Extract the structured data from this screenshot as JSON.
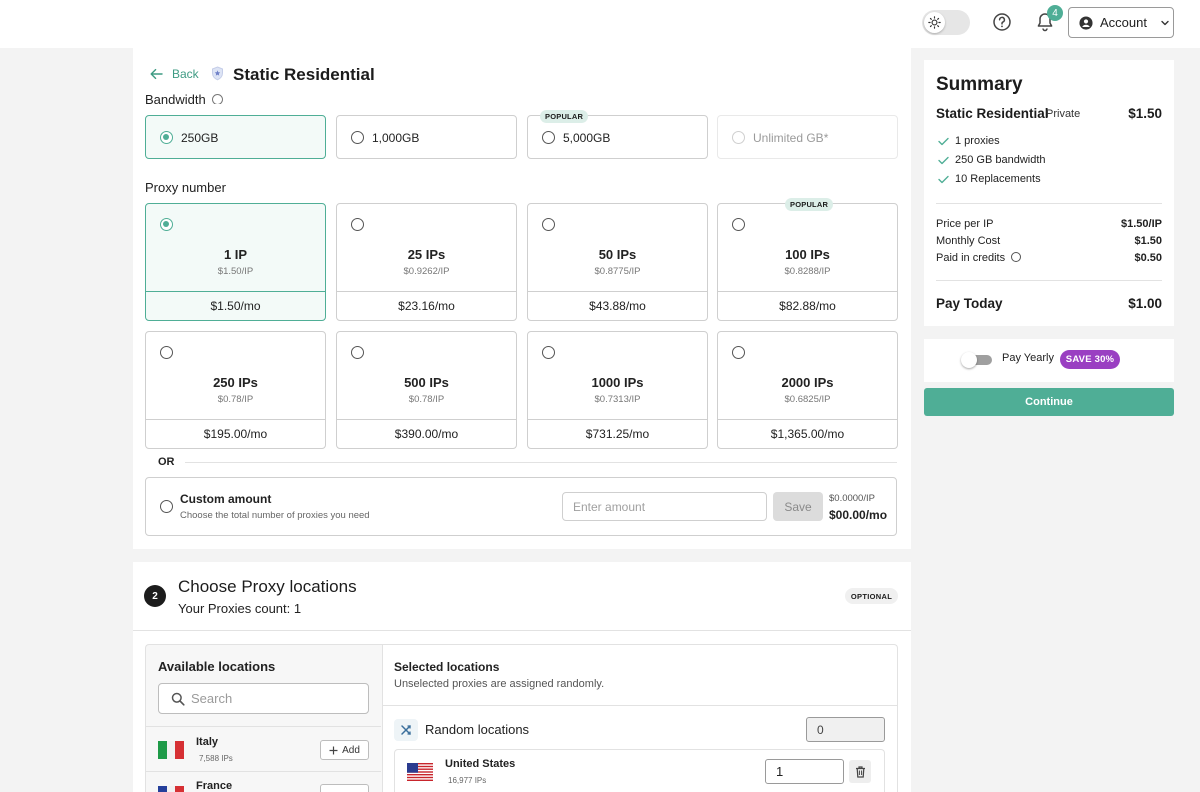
{
  "header": {
    "theme_toggle": "sun-icon",
    "notification_count": "4",
    "account_label": "Account"
  },
  "page": {
    "back_label": "Back",
    "title": "Static Residential",
    "bandwidth_label": "Bandwidth"
  },
  "bandwidth_options": [
    {
      "label": "250GB",
      "selected": true
    },
    {
      "label": "1,000GB",
      "selected": false
    },
    {
      "label": "5,000GB",
      "badge": "POPULAR"
    },
    {
      "label": "Unlimited GB*",
      "disabled": true
    }
  ],
  "proxy_number": {
    "label": "Proxy number",
    "options": [
      {
        "count": "1 IP",
        "per": "$1.50/IP",
        "monthly": "$1.50/mo",
        "selected": true
      },
      {
        "count": "25 IPs",
        "per": "$0.9262/IP",
        "monthly": "$23.16/mo"
      },
      {
        "count": "50 IPs",
        "per": "$0.8775/IP",
        "monthly": "$43.88/mo"
      },
      {
        "count": "100 IPs",
        "per": "$0.8288/IP",
        "monthly": "$82.88/mo",
        "badge": "POPULAR"
      },
      {
        "count": "250 IPs",
        "per": "$0.78/IP",
        "monthly": "$195.00/mo"
      },
      {
        "count": "500 IPs",
        "per": "$0.78/IP",
        "monthly": "$390.00/mo"
      },
      {
        "count": "1000 IPs",
        "per": "$0.7313/IP",
        "monthly": "$731.25/mo"
      },
      {
        "count": "2000 IPs",
        "per": "$0.6825/IP",
        "monthly": "$1,365.00/mo"
      }
    ],
    "or_label": "OR",
    "custom": {
      "title": "Custom amount",
      "subtitle": "Choose the total number of proxies you need",
      "placeholder": "Enter amount",
      "save_label": "Save",
      "price_per_ip": "$0.0000/IP",
      "total": "$00.00/mo"
    }
  },
  "locations": {
    "step": "2",
    "title": "Choose Proxy locations",
    "count_text": "Your Proxies count: 1",
    "optional_badge": "OPTIONAL",
    "available_title": "Available locations",
    "search_placeholder": "Search",
    "add_label": "Add",
    "countries": [
      {
        "name": "Italy",
        "ips": "7,588 IPs"
      },
      {
        "name": "France",
        "ips": ""
      }
    ],
    "selected_title": "Selected locations",
    "selected_subtitle": "Unselected proxies are assigned randomly.",
    "random_label": "Random locations",
    "random_value": "0",
    "selected": [
      {
        "name": "United States",
        "ips": "16,977 IPs",
        "quantity": "1"
      }
    ]
  },
  "summary": {
    "title": "Summary",
    "product": "Static Residential",
    "product_type": "Private",
    "product_price": "$1.50",
    "features": [
      "1 proxies",
      "250 GB bandwidth",
      "10 Replacements"
    ],
    "rows": [
      {
        "label": "Price per IP",
        "value": "$1.50/IP"
      },
      {
        "label": "Monthly Cost",
        "value": "$1.50"
      },
      {
        "label": "Paid in credits",
        "value": "$0.50"
      }
    ],
    "pay_today_label": "Pay Today",
    "pay_today_value": "$1.00",
    "pay_yearly_label": "Pay Yearly",
    "save_badge": "SAVE 30%",
    "continue_label": "Continue"
  },
  "colors": {
    "accent": "#4fae96",
    "badge_purple": "#9a3fc2"
  }
}
